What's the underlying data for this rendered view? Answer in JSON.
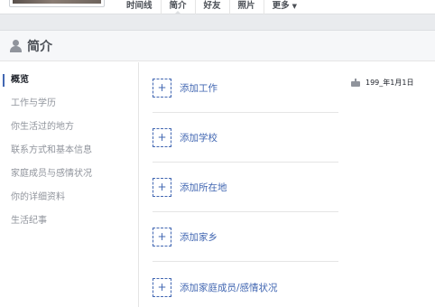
{
  "topnav": {
    "tabs": [
      {
        "name": "tab-timeline",
        "label": "时间线",
        "active": false
      },
      {
        "name": "tab-about",
        "label": "简介",
        "active": true
      },
      {
        "name": "tab-friends",
        "label": "好友",
        "active": false
      },
      {
        "name": "tab-photos",
        "label": "照片",
        "active": false
      }
    ],
    "more_label": "更多",
    "more_icon": "caret-down-icon"
  },
  "about": {
    "title": "简介",
    "title_icon": "person-icon",
    "sidebar": [
      {
        "name": "sidebar-item-overview",
        "label": "概览",
        "active": true
      },
      {
        "name": "sidebar-item-work-education",
        "label": "工作与学历",
        "active": false
      },
      {
        "name": "sidebar-item-places-lived",
        "label": "你生活过的地方",
        "active": false
      },
      {
        "name": "sidebar-item-contact-info",
        "label": "联系方式和基本信息",
        "active": false
      },
      {
        "name": "sidebar-item-family-relationships",
        "label": "家庭成员与感情状况",
        "active": false
      },
      {
        "name": "sidebar-item-details",
        "label": "你的详细资料",
        "active": false
      },
      {
        "name": "sidebar-item-life-events",
        "label": "生活纪事",
        "active": false
      }
    ],
    "add_items": [
      {
        "name": "add-work-button",
        "label": "添加工作"
      },
      {
        "name": "add-school-button",
        "label": "添加学校"
      },
      {
        "name": "add-current-city-button",
        "label": "添加所在地"
      },
      {
        "name": "add-hometown-button",
        "label": "添加家乡"
      },
      {
        "name": "add-family-relationship-button",
        "label": "添加家庭成员/感情状况"
      }
    ],
    "plus_symbol": "+",
    "birthday": {
      "icon": "birthday-cake-icon",
      "text": "199_年1月1日"
    }
  },
  "colors": {
    "link": "#4267b2",
    "muted": "#90949c",
    "background": "#e9ebee"
  }
}
